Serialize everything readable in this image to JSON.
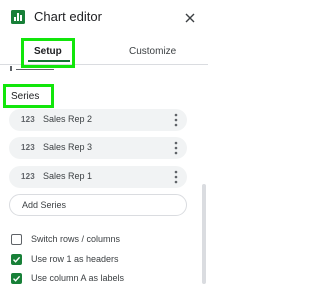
{
  "header": {
    "title": "Chart editor",
    "icon": "chart-bar-icon",
    "close_icon": "close-icon"
  },
  "tabs": [
    {
      "label": "Setup",
      "active": true
    },
    {
      "label": "Customize",
      "active": false
    }
  ],
  "series": {
    "heading": "Series",
    "items": [
      {
        "badge": "123",
        "label": "Sales Rep 2"
      },
      {
        "badge": "123",
        "label": "Sales Rep 3"
      },
      {
        "badge": "123",
        "label": "Sales Rep 1"
      }
    ],
    "add_label": "Add Series"
  },
  "options": [
    {
      "label": "Switch rows / columns",
      "checked": false
    },
    {
      "label": "Use row 1 as headers",
      "checked": true
    },
    {
      "label": "Use column A as labels",
      "checked": true
    }
  ],
  "colors": {
    "accent": "#137333",
    "checkbox": "#188038",
    "highlight": "#12e60b"
  }
}
